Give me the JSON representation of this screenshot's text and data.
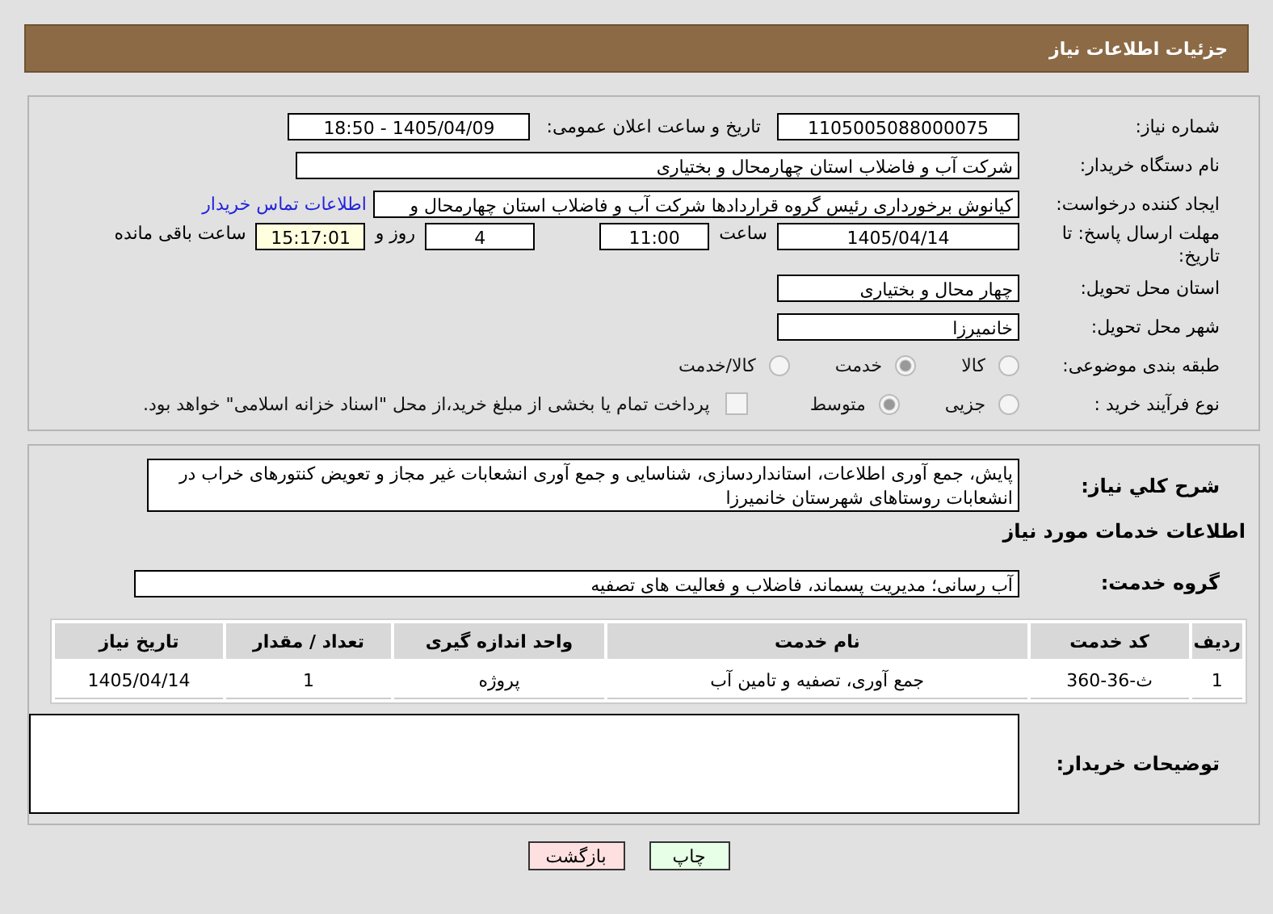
{
  "header": {
    "title": "جزئیات اطلاعات نیاز"
  },
  "need_number": {
    "label": "شماره نیاز:",
    "value": "1105005088000075"
  },
  "announce": {
    "label": "تاریخ و ساعت اعلان عمومی:",
    "value": "1405/04/09 - 18:50"
  },
  "buyer": {
    "label": "نام دستگاه خریدار:",
    "value": "شرکت آب و فاضلاب استان چهارمحال و بختیاری"
  },
  "creator": {
    "label": "ایجاد کننده درخواست:",
    "value": "کیانوش برخورداری رئیس گروه قراردادها شرکت آب و فاضلاب استان چهارمحال و",
    "link": "اطلاعات تماس خریدار"
  },
  "deadline": {
    "label": "مهلت ارسال پاسخ: تا تاریخ:",
    "date": "1405/04/14",
    "time_label": "ساعت",
    "time": "11:00",
    "days": "4",
    "days_label": "روز و",
    "remaining": "15:17:01",
    "remaining_label": "ساعت باقی مانده"
  },
  "province": {
    "label": "استان محل تحویل:",
    "value": "چهار محال و بختیاری"
  },
  "city": {
    "label": "شهر محل تحویل:",
    "value": "خانمیرزا"
  },
  "category": {
    "label": "طبقه بندی موضوعی:",
    "options": [
      {
        "label": "کالا",
        "selected": false
      },
      {
        "label": "خدمت",
        "selected": true
      },
      {
        "label": "کالا/خدمت",
        "selected": false
      }
    ]
  },
  "process": {
    "label": "نوع فرآیند خرید :",
    "options": [
      {
        "label": "جزیی",
        "selected": false
      },
      {
        "label": "متوسط",
        "selected": true
      }
    ],
    "treasury": {
      "checked": false,
      "text": "پرداخت تمام یا بخشی از مبلغ خرید،از محل \"اسناد خزانه اسلامی\" خواهد بود."
    }
  },
  "description": {
    "label": "شرح کلي نياز:",
    "value": "پایش، جمع آوری اطلاعات، استانداردسازی، شناسایی و جمع آوری انشعابات غیر مجاز و تعویض کنتورهای خراب در انشعابات روستاهای شهرستان خانمیرزا"
  },
  "services_title": "اطلاعات خدمات مورد نیاز",
  "service_group": {
    "label": "گروه خدمت:",
    "value": "آب رسانی؛ مدیریت پسماند، فاضلاب و فعالیت های تصفیه"
  },
  "table": {
    "columns": [
      "ردیف",
      "کد خدمت",
      "نام خدمت",
      "واحد اندازه گیری",
      "تعداد / مقدار",
      "تاریخ نیاز"
    ],
    "rows": [
      [
        "1",
        "ث-36-360",
        "جمع آوری، تصفیه و تامین آب",
        "پروژه",
        "1",
        "1405/04/14"
      ]
    ]
  },
  "buyer_notes": {
    "label": "توضیحات خریدار:"
  },
  "buttons": [
    {
      "label": "چاپ",
      "kind": "print"
    },
    {
      "label": "بازگشت",
      "kind": "back"
    }
  ]
}
